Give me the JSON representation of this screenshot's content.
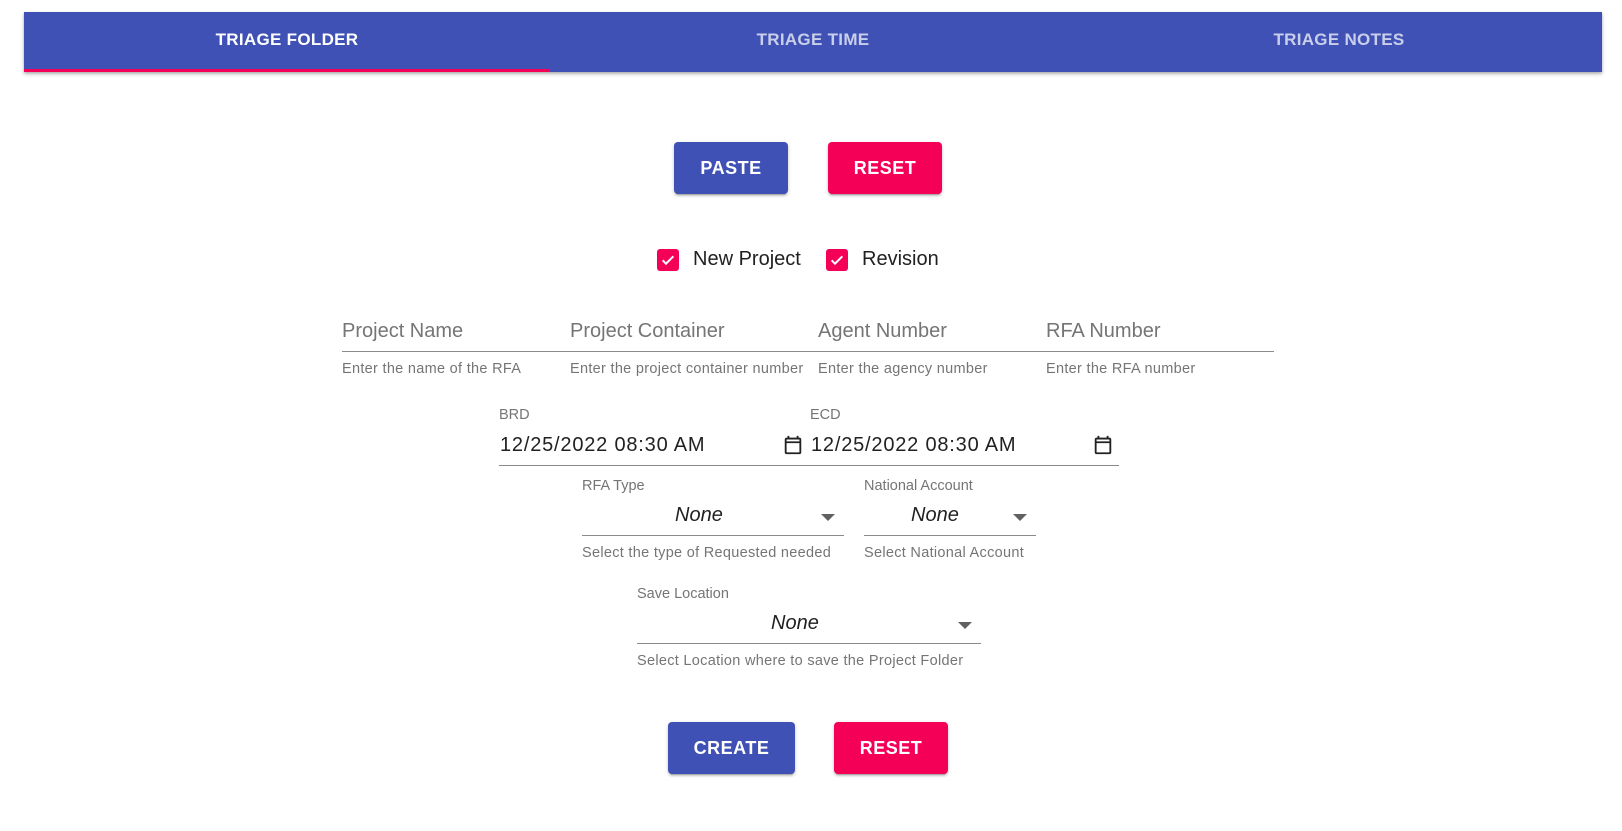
{
  "tabs": [
    {
      "label": "TRIAGE FOLDER",
      "active": true
    },
    {
      "label": "TRIAGE TIME",
      "active": false
    },
    {
      "label": "TRIAGE NOTES",
      "active": false
    }
  ],
  "colors": {
    "primary": "#3f51b5",
    "secondary": "#f50057"
  },
  "top_buttons": {
    "paste": "PASTE",
    "reset": "RESET"
  },
  "checkboxes": [
    {
      "label": "New Project",
      "checked": true
    },
    {
      "label": "Revision",
      "checked": true
    }
  ],
  "text_fields": [
    {
      "placeholder": "Project Name",
      "helper": "Enter the name of the RFA"
    },
    {
      "placeholder": "Project Container",
      "helper": "Enter the project container number"
    },
    {
      "placeholder": "Agent Number",
      "helper": "Enter the agency number"
    },
    {
      "placeholder": "RFA Number",
      "helper": "Enter the RFA number"
    }
  ],
  "dates": [
    {
      "label": "BRD",
      "value": "12/25/2022 08:30 AM",
      "icon": "calendar-icon"
    },
    {
      "label": "ECD",
      "value": "12/25/2022 08:30 AM",
      "icon": "calendar-icon"
    }
  ],
  "selects": {
    "rfa_type": {
      "label": "RFA Type",
      "value": "None",
      "helper": "Select the type of Requested needed"
    },
    "national_account": {
      "label": "National Account",
      "value": "None",
      "helper": "Select National Account"
    },
    "save_location": {
      "label": "Save Location",
      "value": "None",
      "helper": "Select Location where to save the Project Folder"
    }
  },
  "bottom_buttons": {
    "create": "CREATE",
    "reset": "RESET"
  }
}
